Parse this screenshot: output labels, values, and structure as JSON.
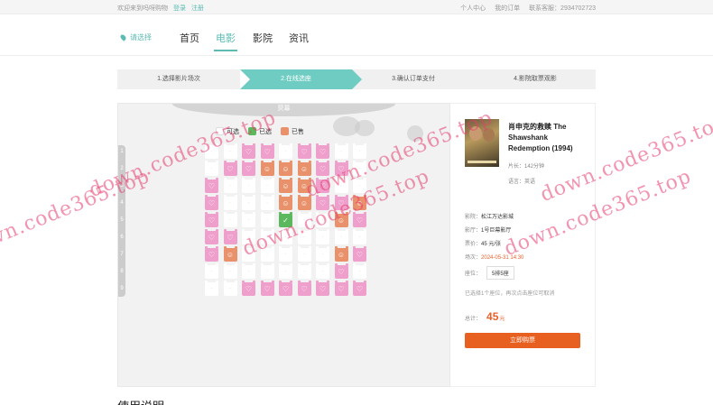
{
  "topbar": {
    "welcome": "欢迎来到吗呀购物",
    "login": "登录",
    "register": "注册",
    "user_center": "个人中心",
    "my_orders": "我的订单",
    "support": "联系客服：2934702723"
  },
  "nav": {
    "location": "请选择",
    "items": [
      "首页",
      "电影",
      "影院",
      "资讯"
    ],
    "active": "电影"
  },
  "steps": [
    "1.选择影片场次",
    "2.在线选座",
    "3.确认订单支付",
    "4.影院取票观影"
  ],
  "seat_map": {
    "screen_label": "荧幕",
    "legend": {
      "available": "可选",
      "selected": "已选",
      "sold": "已售"
    },
    "row_numbers": [
      "1",
      "2",
      "3",
      "4",
      "5",
      "6",
      "7",
      "8",
      "9"
    ],
    "rows": [
      "..LL.LL..",
      "ALLSSSLLA",
      "LAAASSLA.",
      "LAAASSLLS",
      "LAAAX..SL",
      "LL.......",
      "LSAA.A.SL",
      "A....A.L.",
      "A.LLLLLLL"
    ]
  },
  "movie": {
    "title": "肖申克的救赎 The Shawshank Redemption (1994)",
    "duration": "片长：142分钟",
    "language": "语言：英语",
    "cinema_label": "影院：",
    "cinema": "松江万达影城",
    "hall_label": "影厅：",
    "hall": "1号巨幕影厅",
    "price_label": "票价：",
    "price": "45 元/张",
    "time_label": "场次：",
    "time": "2024-05-31 14:30",
    "seat_label": "座位：",
    "seat": "5排5座",
    "hint": "已选择1个座位，再次点击座位可取消",
    "total_label": "总计：",
    "total_amount": "45",
    "total_unit": "元",
    "buy_button": "立即购票"
  },
  "section_title": "使用说明",
  "watermark": "down.code365.top",
  "colors": {
    "accent": "#5cbcb3",
    "step_active": "#6fccc2",
    "sold_seat": "#e8916a",
    "love_seat": "#ef9fcb",
    "selected_seat": "#5cb85c",
    "buy_button": "#e8601f",
    "price": "#e85f2a"
  }
}
